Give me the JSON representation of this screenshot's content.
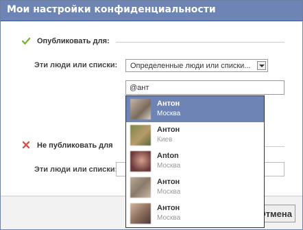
{
  "dialog": {
    "title": "Мои настройки конфиденциальности"
  },
  "publish": {
    "heading": "Опубликовать для:",
    "people_label": "Эти люди или списки:",
    "select_value": "Определенные люди или списки...",
    "input_value": "@ант"
  },
  "not_publish": {
    "heading": "Не публиковать для",
    "people_label": "Эти люди или списки:"
  },
  "footer": {
    "cancel_label": "Отмена"
  },
  "suggestions": [
    {
      "name": "Антон",
      "city": "Москва",
      "selected": true
    },
    {
      "name": "Антон",
      "city": "Киев",
      "selected": false
    },
    {
      "name": "Anton",
      "city": "Москва",
      "selected": false
    },
    {
      "name": "Антон",
      "city": "Москва",
      "selected": false
    },
    {
      "name": "Антон",
      "city": "Москва",
      "selected": false
    }
  ],
  "colors": {
    "title_bar": "#6d84b4",
    "selected_option": "#6d84b4",
    "check": "#7fb23a",
    "cross": "#d9534f"
  }
}
